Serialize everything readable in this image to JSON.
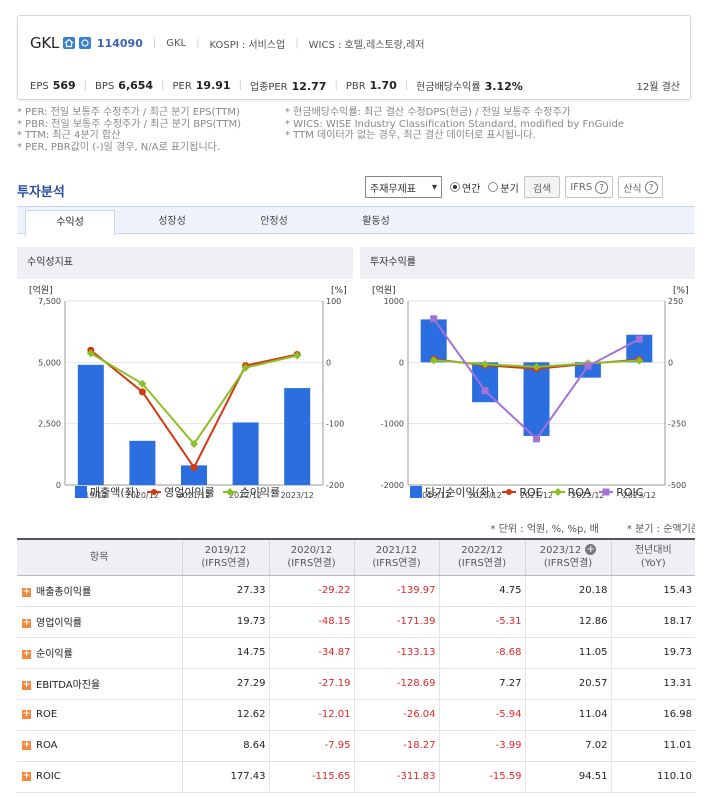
{
  "company": {
    "name": "GKL",
    "code": "114090",
    "short": "GKL",
    "market": "KOSPI : 서비스업",
    "wics": "WICS : 호텔,레스토랑,레저"
  },
  "kpis": [
    {
      "label": "EPS",
      "value": "569"
    },
    {
      "label": "BPS",
      "value": "6,654"
    },
    {
      "label": "PER",
      "value": "19.91"
    },
    {
      "label": "업종PER",
      "value": "12.77"
    },
    {
      "label": "PBR",
      "value": "1.70"
    },
    {
      "label": "현금배당수익률",
      "value": "3.12%"
    }
  ],
  "fiscal": "12월 결산",
  "notes_left": [
    "* PER: 전일 보통주 수정주가 / 최근 분기 EPS(TTM)",
    "* PBR: 전일 보통주 수정주가 / 최근 분기 BPS(TTM)",
    "* TTM: 최근 4분기 합산",
    "* PER, PBR값이 (-)일 경우, N/A로 표기됩니다."
  ],
  "notes_right": [
    "* 현금배당수익률: 최근 결산 수정DPS(현금) / 전일 보통주 수정주가",
    "* WICS: WISE Industry Classification Standard, modified by FnGuide",
    "* TTM 데이터가 없는 경우, 최근 결산 데이터로 표시됩니다."
  ],
  "section_title": "투자분석",
  "controls": {
    "select": "주재무제표",
    "radio_year": "연간",
    "radio_quarter": "분기",
    "search": "검색",
    "ifrs": "IFRS",
    "glossary": "산식"
  },
  "tabs": [
    "수익성",
    "성장성",
    "안정성",
    "활동성"
  ],
  "panel_left_title": "수익성지표",
  "panel_right_title": "투자수익률",
  "chart_data": [
    {
      "type": "bar",
      "categories": [
        "2019/12",
        "2020/12",
        "2021/12",
        "2022/12",
        "2023/12"
      ],
      "series": [
        {
          "name": "매출액(좌)",
          "axis": "left",
          "kind": "bar",
          "values": [
            4900,
            1800,
            800,
            2550,
            3950
          ],
          "color": "#2b6ee0"
        },
        {
          "name": "영업이익률",
          "axis": "right",
          "kind": "line",
          "values": [
            19.73,
            -48.15,
            -171.39,
            -5.31,
            12.86
          ],
          "color": "#d03a10"
        },
        {
          "name": "순이익률",
          "axis": "right",
          "kind": "line",
          "values": [
            14.75,
            -34.87,
            -133.13,
            -8.68,
            11.05
          ],
          "color": "#8cbf26"
        }
      ],
      "ylabel_left": "[억원]",
      "ylabel_right": "[%]",
      "ylim_left": [
        0,
        7500
      ],
      "ylim_right": [
        -200,
        100
      ],
      "yticks_left": [
        "7,500",
        "5,000",
        "2,500",
        "0"
      ],
      "yticks_right": [
        "100",
        "0",
        "-100",
        "-200"
      ]
    },
    {
      "type": "bar",
      "categories": [
        "2019/12",
        "2020/12",
        "2021/12",
        "2022/12",
        "2023/12"
      ],
      "series": [
        {
          "name": "당기순이익(좌)",
          "axis": "left",
          "kind": "bar",
          "values": [
            700,
            -650,
            -1200,
            -250,
            450
          ],
          "color": "#2b6ee0"
        },
        {
          "name": "ROE",
          "axis": "right",
          "kind": "line",
          "values": [
            12.62,
            -12.01,
            -26.04,
            -5.94,
            11.04
          ],
          "color": "#d03a10"
        },
        {
          "name": "ROA",
          "axis": "right",
          "kind": "line",
          "values": [
            8.64,
            -7.95,
            -18.27,
            -3.99,
            7.02
          ],
          "color": "#8cbf26"
        },
        {
          "name": "ROIC",
          "axis": "right",
          "kind": "line",
          "values": [
            177.43,
            -115.65,
            -311.83,
            -15.59,
            94.51
          ],
          "color": "#a371d8"
        }
      ],
      "ylabel_left": "[억원]",
      "ylabel_right": "[%]",
      "ylim_left": [
        -2000,
        1000
      ],
      "ylim_right": [
        -500,
        250
      ],
      "yticks_left": [
        "1000",
        "0",
        "-1000",
        "-2000"
      ],
      "yticks_right": [
        "250",
        "0",
        "-250",
        "-500"
      ]
    }
  ],
  "unit_note": "* 단위 : 억원, %, %p, 배",
  "freq_note": "* 분기 : 순액기준",
  "table": {
    "headers": [
      "항목",
      "2019/12\n(IFRS연결)",
      "2020/12\n(IFRS연결)",
      "2021/12\n(IFRS연결)",
      "2022/12\n(IFRS연결)",
      "2023/12\n(IFRS연결)",
      "전년대비\n(YoY)"
    ],
    "rows": [
      {
        "label": "매출총이익률",
        "values": [
          "27.33",
          "-29.22",
          "-139.97",
          "4.75",
          "20.18",
          "15.43"
        ]
      },
      {
        "label": "영업이익률",
        "values": [
          "19.73",
          "-48.15",
          "-171.39",
          "-5.31",
          "12.86",
          "18.17"
        ]
      },
      {
        "label": "순이익률",
        "values": [
          "14.75",
          "-34.87",
          "-133.13",
          "-8.68",
          "11.05",
          "19.73"
        ]
      },
      {
        "label": "EBITDA마진율",
        "values": [
          "27.29",
          "-27.19",
          "-128.69",
          "7.27",
          "20.57",
          "13.31"
        ]
      },
      {
        "label": "ROE",
        "values": [
          "12.62",
          "-12.01",
          "-26.04",
          "-5.94",
          "11.04",
          "16.98"
        ]
      },
      {
        "label": "ROA",
        "values": [
          "8.64",
          "-7.95",
          "-18.27",
          "-3.99",
          "7.02",
          "11.01"
        ]
      },
      {
        "label": "ROIC",
        "values": [
          "177.43",
          "-115.65",
          "-311.83",
          "-15.59",
          "94.51",
          "110.10"
        ]
      }
    ]
  }
}
